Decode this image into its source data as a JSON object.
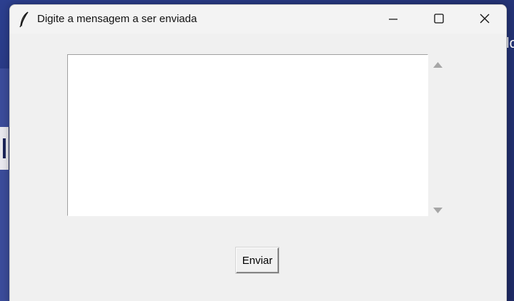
{
  "window": {
    "title": "Digite a mensagem a ser enviada",
    "icon": "feather-icon",
    "controls": {
      "minimize_icon": "minimize-icon",
      "maximize_icon": "maximize-icon",
      "close_icon": "close-icon"
    }
  },
  "message_box": {
    "value": "",
    "scrollbar": {
      "up_icon": "scroll-up-arrow-icon",
      "down_icon": "scroll-down-arrow-icon"
    }
  },
  "send_button": {
    "label": "Enviar"
  },
  "background": {
    "partial_text": "lo"
  },
  "colors": {
    "window_bg": "#f0f0f0",
    "desktop_bg": "#233274"
  }
}
